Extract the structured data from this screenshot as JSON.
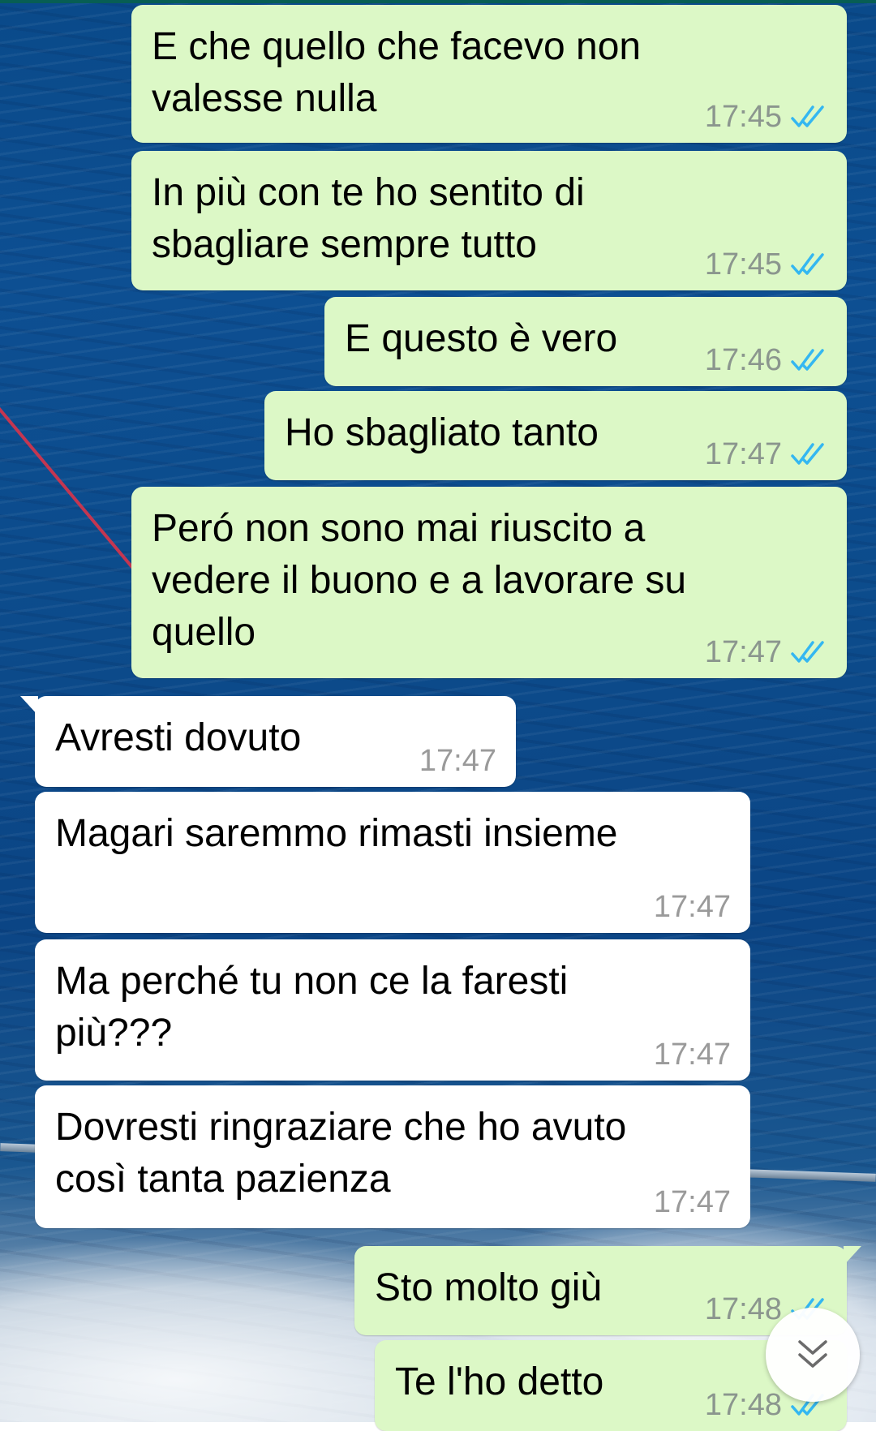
{
  "chat": {
    "messages": [
      {
        "direction": "outgoing",
        "text": "E che quello che facevo non\nvalesse nulla",
        "time": "17:45",
        "status": "read"
      },
      {
        "direction": "outgoing",
        "text": "In più con te ho sentito di\nsbagliare sempre tutto",
        "time": "17:45",
        "status": "read"
      },
      {
        "direction": "outgoing",
        "text": "E questo è vero",
        "time": "17:46",
        "status": "read"
      },
      {
        "direction": "outgoing",
        "text": "Ho sbagliato tanto",
        "time": "17:47",
        "status": "read"
      },
      {
        "direction": "outgoing",
        "text": "Peró non sono mai riuscito a\nvedere il buono e a lavorare su\nquello",
        "time": "17:47",
        "status": "read"
      },
      {
        "direction": "incoming",
        "text": "Avresti dovuto",
        "time": "17:47"
      },
      {
        "direction": "incoming",
        "text": "Magari saremmo rimasti insieme",
        "time": "17:47"
      },
      {
        "direction": "incoming",
        "text": "Ma perché tu non ce la faresti\npiù???",
        "time": "17:47"
      },
      {
        "direction": "incoming",
        "text": "Dovresti ringraziare che ho avuto\ncosì tanta pazienza",
        "time": "17:47"
      },
      {
        "direction": "outgoing",
        "text": "Sto molto giù",
        "time": "17:48",
        "status": "read"
      },
      {
        "direction": "outgoing",
        "text": "Te l'ho detto",
        "time": "17:48",
        "status": "read"
      }
    ]
  },
  "colors": {
    "outgoing_bubble": "#dcf8c6",
    "incoming_bubble": "#ffffff",
    "read_ticks": "#34b7f1",
    "header": "#075e54"
  },
  "icons": {
    "read_receipt": "double-check-icon",
    "scroll_down": "chevron-double-down-icon"
  }
}
